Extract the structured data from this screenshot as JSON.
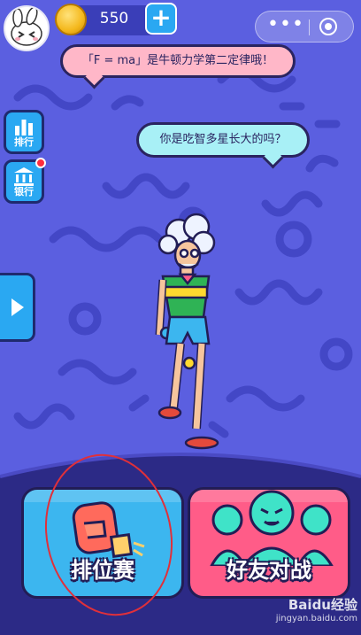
{
  "topbar": {
    "coin_count": "550",
    "plus_icon": "plus-icon",
    "menu_icon": "more-dots-icon",
    "close_icon": "target-close-icon"
  },
  "bubbles": {
    "tip": "「F = ma」是牛顿力学第二定律哦！",
    "question": "你是吃智多星长大的吗？"
  },
  "side": {
    "rank_label": "排行",
    "bank_label": "银行",
    "rank_icon": "bar-chart-icon",
    "bank_icon": "bank-icon",
    "play_icon": "play-icon"
  },
  "modes": {
    "ranked_label": "排位赛",
    "friends_label": "好友对战",
    "ranked_icon": "boxing-glove-icon",
    "friends_icon": "crowd-icon"
  },
  "watermark": {
    "text": "Baidu经验",
    "sub": "jingyan.baidu.com"
  },
  "colors": {
    "background": "#5b5fe0",
    "accent_blue": "#2aa8f2",
    "card_blue": "#3cb6ef",
    "card_pink": "#ff5c88",
    "outline": "#221d55",
    "annotation_red": "#e0303a"
  }
}
